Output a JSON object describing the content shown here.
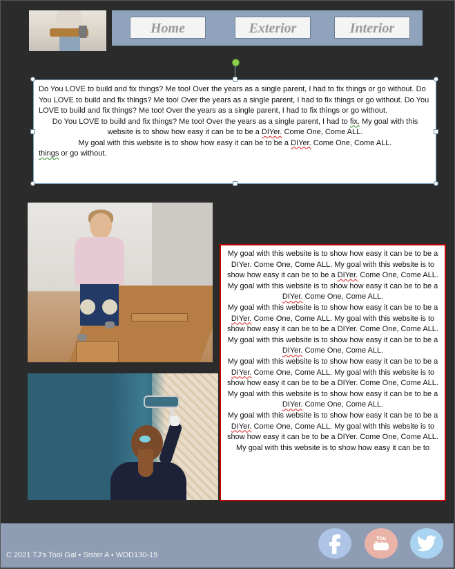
{
  "nav": {
    "home": "Home",
    "exterior": "Exterior",
    "interior": "Interior"
  },
  "textbox": {
    "para1": "Do You LOVE to build and fix things?  Me too!  Over the years as a single parent, I had to fix things or go without. Do You LOVE to build and fix things?  Me too!  Over the years as a single parent, I had to fix things or go without. Do You LOVE to build and fix things?  Me too!  Over the years as a single parent, I had to fix things or go without.",
    "para2_a": "Do You LOVE to build and fix things?  Me too!  Over the years as a single parent, I had to ",
    "para2_fix": "fix.",
    "para2_b": " My goal with this website is to show how easy it can be to be a ",
    "para2_diyer": "DIYer.",
    "para2_c": "  Come One, Come ALL.",
    "para3_a": "My goal with this website is to show how easy it can be to be a ",
    "para3_diyer": "DIYer.",
    "para3_b": "  Come One, Come ALL.",
    "para4_things": "things",
    "para4_b": " or go without."
  },
  "redbox": {
    "lines": [
      {
        "pre": "My goal with this website is to show how easy it can be to be a DIYer.  Come One, Come ALL. My goal with this website is to show how easy it can be to be a ",
        "diyer": "DIYer.",
        "post": "  Come One, Come ALL."
      },
      {
        "pre": "My goal with this website is to show how easy it can be to be a ",
        "diyer": "DIYer.",
        "post": "  Come One, Come ALL."
      },
      {
        "pre": "My goal with this website is to show how easy it can be to be a ",
        "diyer": "DIYer.",
        "post": "  Come One, Come ALL. My goal with this website is to show how easy it can be to be a DIYer.  Come One, Come ALL."
      },
      {
        "pre": "My goal with this website is to show how easy it can be to be a ",
        "diyer": "DIYer.",
        "post": "  Come One, Come ALL."
      },
      {
        "pre": "My goal with this website is to show how easy it can be to be a ",
        "diyer": "DIYer.",
        "post": "  Come One, Come ALL. My goal with this website is to show how easy it can be to be a DIYer.  Come One, Come ALL."
      },
      {
        "pre": "My goal with this website is to show how easy it can be to be a ",
        "diyer": "DIYer.",
        "post": "  Come One, Come ALL."
      },
      {
        "pre": "My goal with this website is to show how easy it can be to be a ",
        "diyer": "DIYer.",
        "post": "  Come One, Come ALL. My goal with this website is to show how easy it can be to be a DIYer.  Come One, Come ALL."
      },
      {
        "pre": "My goal with this website is to show how easy it can be to",
        "diyer": "",
        "post": ""
      }
    ]
  },
  "footer": {
    "copyright": "C  2021 TJ’s Tool Gal  •  Sister A  •  WDD130-19",
    "youtube_label": "You Tube"
  },
  "colors": {
    "background": "#2b2b2b",
    "nav_bar": "#8fa3bc",
    "footer": "#8e9db4",
    "red_border": "#c00000",
    "facebook": "#adc4e6",
    "youtube": "#e9b3a8",
    "twitter": "#a9d3f0"
  },
  "icons": [
    "facebook-icon",
    "youtube-icon",
    "twitter-icon"
  ]
}
